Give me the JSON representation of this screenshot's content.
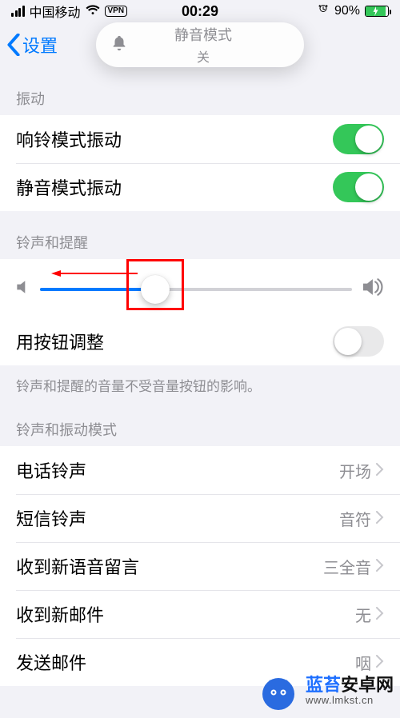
{
  "status": {
    "carrier": "中国移动",
    "vpn": "VPN",
    "time": "00:29",
    "battery_pct": "90%"
  },
  "nav": {
    "back_label": "设置"
  },
  "toast": {
    "title": "静音模式",
    "sub": "关"
  },
  "sections": {
    "vibrate_header": "振动",
    "ring_vibrate": {
      "label": "响铃模式振动",
      "on": true
    },
    "silent_vibrate": {
      "label": "静音模式振动",
      "on": true
    },
    "ringer_header": "铃声和提醒",
    "volume_pct": 37,
    "button_adjust": {
      "label": "用按钮调整",
      "on": false
    },
    "footer": "铃声和提醒的音量不受音量按钮的影响。",
    "patterns_header": "铃声和振动模式",
    "rows": [
      {
        "label": "电话铃声",
        "value": "开场"
      },
      {
        "label": "短信铃声",
        "value": "音符"
      },
      {
        "label": "收到新语音留言",
        "value": "三全音"
      },
      {
        "label": "收到新邮件",
        "value": "无"
      },
      {
        "label": "发送邮件",
        "value": "咽"
      }
    ]
  },
  "watermark": {
    "brand_blue": "蓝苔",
    "brand_black": "安卓网",
    "url": "www.lmkst.cn"
  }
}
